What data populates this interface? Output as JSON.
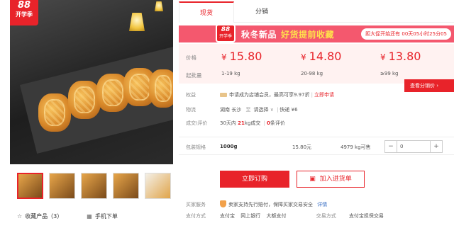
{
  "badge": {
    "num": "88",
    "text": "开学季"
  },
  "left": {
    "collect_label": "收藏产品（3）",
    "mobile_order_label": "手机下单",
    "collect_icon": "star-icon",
    "mobile_icon": "grid-icon"
  },
  "tabs": [
    {
      "label": "现货"
    },
    {
      "label": "分销"
    }
  ],
  "promo": {
    "logo_num": "88",
    "logo_text": "开学季",
    "slogan_white": "秋冬新品",
    "slogan_yellow": "好货提前收藏",
    "countdown": "距大促开始还有 00天05小时25分05"
  },
  "price": {
    "label": "价格",
    "qty_label": "起批量",
    "currency": "¥",
    "tiers": [
      {
        "price": "15.80",
        "qty": "1-19 kg"
      },
      {
        "price": "14.80",
        "qty": "20-98 kg"
      },
      {
        "price": "13.80",
        "qty": "≥99 kg"
      }
    ],
    "detail_button": "查看分销价 ›"
  },
  "rights": {
    "label": "权益",
    "text": "申请成为店铺会员，最高可享9.97折",
    "link": "立即申请"
  },
  "logistics": {
    "label": "物流",
    "from": "湖南 长沙",
    "to_word": "至",
    "to": "请选择",
    "express": "快递 ¥6"
  },
  "deals": {
    "label": "成交\\评价",
    "prefix": "30天内",
    "count": "21",
    "unit": "kg成交",
    "review_count": "0",
    "review_word": "条评价"
  },
  "spec": {
    "label": "包装规格",
    "name": "1000g",
    "price": "15.80元",
    "stock": "4979 kg可售",
    "qty_value": "0",
    "minus": "−",
    "plus": "+"
  },
  "actions": {
    "order": "立即订购",
    "cart": "加入进货单"
  },
  "service": {
    "label": "买家服务",
    "text": "卖家支持先行赔付，保障买家交易安全",
    "link": "详情"
  },
  "payment": {
    "label": "支付方式",
    "methods": [
      "支付宝",
      "网上银行",
      "大额支付"
    ],
    "label2": "交易方式",
    "method2": "支付宝担保交易"
  }
}
